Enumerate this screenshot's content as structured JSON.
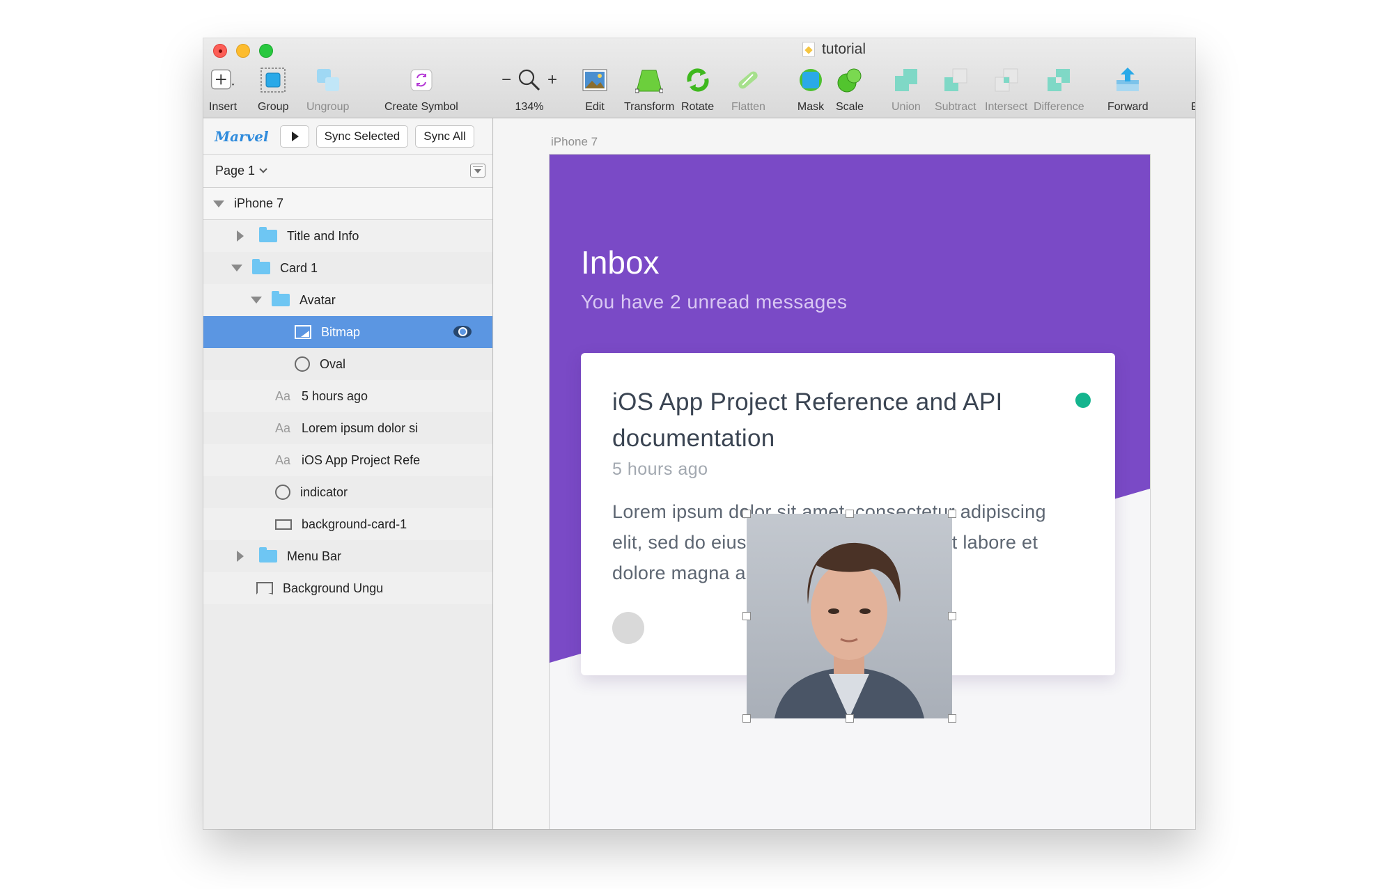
{
  "window": {
    "title": "tutorial"
  },
  "toolbar": {
    "insert": "Insert",
    "group": "Group",
    "ungroup": "Ungroup",
    "create_symbol": "Create Symbol",
    "zoom": "134%",
    "zoom_minus": "−",
    "zoom_plus": "+",
    "edit": "Edit",
    "transform": "Transform",
    "rotate": "Rotate",
    "flatten": "Flatten",
    "mask": "Mask",
    "scale": "Scale",
    "union": "Union",
    "subtract": "Subtract",
    "intersect": "Intersect",
    "difference": "Difference",
    "forward": "Forward",
    "backward_clipped": "E"
  },
  "marvel": {
    "logo": "Marvel",
    "sync_selected": "Sync Selected",
    "sync_all": "Sync All"
  },
  "page": {
    "name": "Page 1"
  },
  "layers": {
    "artboard": "iPhone 7",
    "title_and_info": "Title and Info",
    "card_1": "Card 1",
    "avatar": "Avatar",
    "bitmap": "Bitmap",
    "oval": "Oval",
    "text_time": "5 hours ago",
    "text_body": "Lorem ipsum dolor si",
    "text_title": "iOS App Project Refe",
    "indicator": "indicator",
    "background_card": "background-card-1",
    "menu_bar": "Menu Bar",
    "background_ungu": "Background Ungu",
    "text_marker": "Aa"
  },
  "canvas": {
    "artboard_label": "iPhone 7",
    "inbox_title": "Inbox",
    "inbox_subtitle": "You have 2 unread messages",
    "card_title": "iOS App Project Reference and API documentation",
    "card_time": "5 hours ago",
    "card_body": "Lorem ipsum dolor sit amet, consectetur adipiscing elit, sed do eiusmod tempor incididunt ut labore et dolore magna aliqua..."
  },
  "colors": {
    "accent_purple": "#7a4ac6",
    "selection_blue": "#5b96e2",
    "indicator_green": "#14b48e"
  }
}
